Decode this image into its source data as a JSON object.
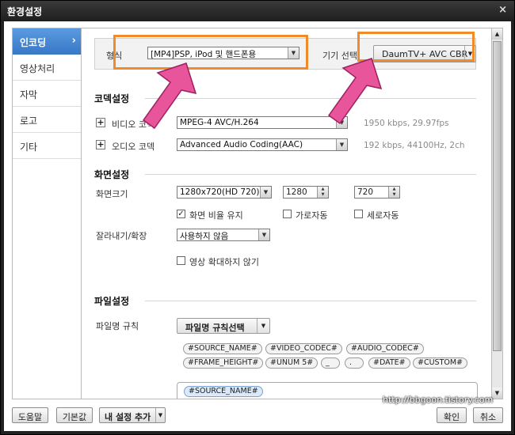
{
  "window": {
    "title": "환경설정",
    "close_glyph": "×"
  },
  "sidebar": {
    "items": [
      {
        "label": "인코딩",
        "active": true
      },
      {
        "label": "영상처리"
      },
      {
        "label": "자막"
      },
      {
        "label": "로고"
      },
      {
        "label": "기타"
      }
    ],
    "active_arrow": "›"
  },
  "format": {
    "label": "형식",
    "value": "[MP4]PSP, iPod 및 핸드폰용",
    "device_label": "기기 선택",
    "device_value": "DaumTV+ AVC CBR"
  },
  "codec": {
    "title": "코덱설정",
    "video": {
      "label": "비디오 코덱",
      "value": "MPEG-4 AVC/H.264",
      "info": "1950 kbps, 29.97fps"
    },
    "audio": {
      "label": "오디오 코덱",
      "value": "Advanced Audio Coding(AAC)",
      "info": "192 kbps, 44100Hz, 2ch"
    }
  },
  "screen": {
    "title": "화면설정",
    "size_label": "화면크기",
    "size_value": "1280x720(HD 720)",
    "width": "1280",
    "height": "720",
    "keep_ratio": {
      "label": "화면 비율 유지",
      "checked": true
    },
    "auto_width": {
      "label": "가로자동",
      "checked": false
    },
    "auto_height": {
      "label": "세로자동",
      "checked": false
    },
    "crop_label": "잘라내기/확장",
    "crop_value": "사용하지 않음",
    "no_upscale": {
      "label": "영상 확대하지 않기",
      "checked": false
    }
  },
  "file": {
    "title": "파일설정",
    "rule_label": "파일명 규칙",
    "rule_button": "파일명 규칙선택",
    "tags_row1": [
      "#SOURCE_NAME#",
      "#VIDEO_CODEC#",
      "#AUDIO_CODEC#"
    ],
    "tags_row2": [
      "#FRAME_HEIGHT#",
      "#UNUM 5#",
      "_",
      ".",
      "#DATE#",
      "#CUSTOM#"
    ],
    "pattern_tag": "#SOURCE_NAME#"
  },
  "footer": {
    "help": "도움말",
    "default": "기본값",
    "add_setting": "내 설정 추가",
    "ok": "확인",
    "cancel": "취소",
    "watermark": "http://bbgoon.tistory.com"
  },
  "colors": {
    "highlight": "#f08a2a",
    "arrow": "#e8559a",
    "active_tab": "#4a8ad6"
  }
}
